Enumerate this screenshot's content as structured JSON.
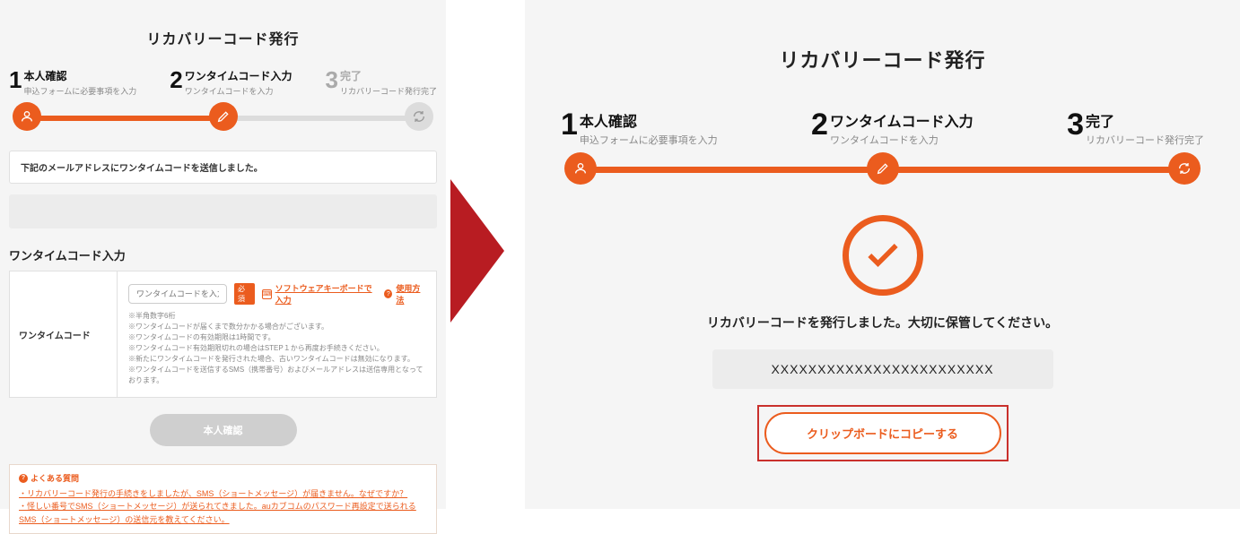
{
  "left": {
    "title": "リカバリーコード発行",
    "steps": [
      {
        "num": "1",
        "label": "本人確認",
        "sub": "申込フォームに必要事項を入力",
        "active": true
      },
      {
        "num": "2",
        "label": "ワンタイムコード入力",
        "sub": "ワンタイムコードを入力",
        "active": true
      },
      {
        "num": "3",
        "label": "完了",
        "sub": "リカバリーコード発行完了",
        "active": false
      }
    ],
    "progress_fill_pct": 50,
    "info_text": "下記のメールアドレスにワンタイムコードを送信しました。",
    "section_header": "ワンタイムコード入力",
    "field_label": "ワンタイムコード",
    "input_placeholder": "ワンタイムコードを入力",
    "req_label": "必須",
    "kbd_link": "ソフトウェアキーボードで入力",
    "usage_link": "使用方法",
    "notes": [
      "半角数字6桁",
      "ワンタイムコードが届くまで数分かかる場合がございます。",
      "ワンタイムコードの有効期限は1時間です。",
      "ワンタイムコード有効期限切れの場合はSTEP１から再度お手続きください。",
      "新たにワンタイムコードを発行された場合、古いワンタイムコードは無効になります。",
      "ワンタイムコードを送信するSMS（携帯番号）およびメールアドレスは送信専用となっております。"
    ],
    "verify_btn": "本人確認",
    "faq_title": "よくある質問",
    "faq_links": [
      "・リカバリーコード発行の手続きをしましたが、SMS（ショートメッセージ）が届きません。なぜですか？",
      "・怪しい番号でSMS（ショートメッセージ）が送られてきました。auカブコムのパスワード再設定で送られるSMS（ショートメッセージ）の送信元を教えてください。"
    ]
  },
  "right": {
    "title": "リカバリーコード発行",
    "steps": [
      {
        "num": "1",
        "label": "本人確認",
        "sub": "申込フォームに必要事項を入力"
      },
      {
        "num": "2",
        "label": "ワンタイムコード入力",
        "sub": "ワンタイムコードを入力"
      },
      {
        "num": "3",
        "label": "完了",
        "sub": "リカバリーコード発行完了"
      }
    ],
    "progress_fill_pct": 100,
    "issued_text": "リカバリーコードを発行しました。大切に保管してください。",
    "code": "XXXXXXXXXXXXXXXXXXXXXXXX",
    "copy_btn": "クリップボードにコピーする"
  },
  "colors": {
    "accent": "#eb5c1e",
    "arrow": "#b81c22"
  }
}
